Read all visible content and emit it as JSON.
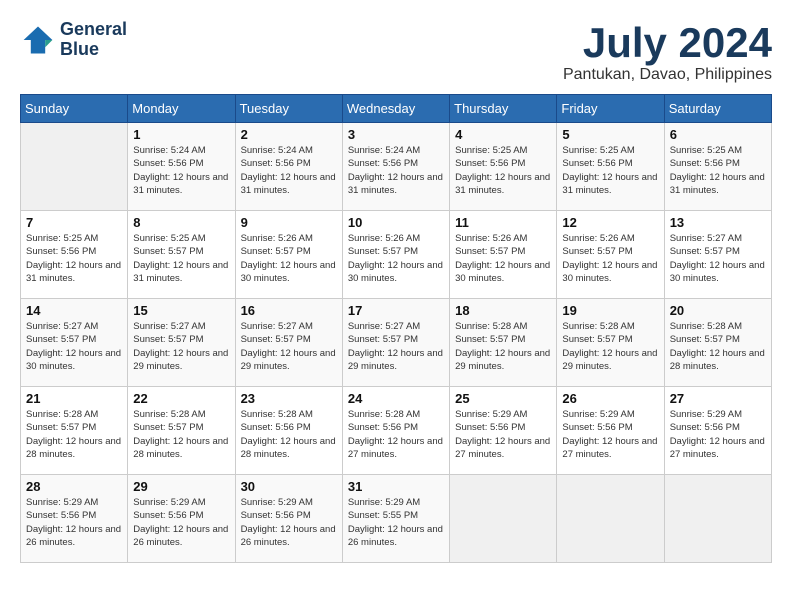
{
  "logo": {
    "line1": "General",
    "line2": "Blue"
  },
  "title": "July 2024",
  "location": "Pantukan, Davao, Philippines",
  "days_of_week": [
    "Sunday",
    "Monday",
    "Tuesday",
    "Wednesday",
    "Thursday",
    "Friday",
    "Saturday"
  ],
  "weeks": [
    [
      {
        "num": "",
        "empty": true
      },
      {
        "num": "1",
        "sunrise": "5:24 AM",
        "sunset": "5:56 PM",
        "daylight": "12 hours and 31 minutes."
      },
      {
        "num": "2",
        "sunrise": "5:24 AM",
        "sunset": "5:56 PM",
        "daylight": "12 hours and 31 minutes."
      },
      {
        "num": "3",
        "sunrise": "5:24 AM",
        "sunset": "5:56 PM",
        "daylight": "12 hours and 31 minutes."
      },
      {
        "num": "4",
        "sunrise": "5:25 AM",
        "sunset": "5:56 PM",
        "daylight": "12 hours and 31 minutes."
      },
      {
        "num": "5",
        "sunrise": "5:25 AM",
        "sunset": "5:56 PM",
        "daylight": "12 hours and 31 minutes."
      },
      {
        "num": "6",
        "sunrise": "5:25 AM",
        "sunset": "5:56 PM",
        "daylight": "12 hours and 31 minutes."
      }
    ],
    [
      {
        "num": "7",
        "sunrise": "5:25 AM",
        "sunset": "5:56 PM",
        "daylight": "12 hours and 31 minutes."
      },
      {
        "num": "8",
        "sunrise": "5:25 AM",
        "sunset": "5:57 PM",
        "daylight": "12 hours and 31 minutes."
      },
      {
        "num": "9",
        "sunrise": "5:26 AM",
        "sunset": "5:57 PM",
        "daylight": "12 hours and 30 minutes."
      },
      {
        "num": "10",
        "sunrise": "5:26 AM",
        "sunset": "5:57 PM",
        "daylight": "12 hours and 30 minutes."
      },
      {
        "num": "11",
        "sunrise": "5:26 AM",
        "sunset": "5:57 PM",
        "daylight": "12 hours and 30 minutes."
      },
      {
        "num": "12",
        "sunrise": "5:26 AM",
        "sunset": "5:57 PM",
        "daylight": "12 hours and 30 minutes."
      },
      {
        "num": "13",
        "sunrise": "5:27 AM",
        "sunset": "5:57 PM",
        "daylight": "12 hours and 30 minutes."
      }
    ],
    [
      {
        "num": "14",
        "sunrise": "5:27 AM",
        "sunset": "5:57 PM",
        "daylight": "12 hours and 30 minutes."
      },
      {
        "num": "15",
        "sunrise": "5:27 AM",
        "sunset": "5:57 PM",
        "daylight": "12 hours and 29 minutes."
      },
      {
        "num": "16",
        "sunrise": "5:27 AM",
        "sunset": "5:57 PM",
        "daylight": "12 hours and 29 minutes."
      },
      {
        "num": "17",
        "sunrise": "5:27 AM",
        "sunset": "5:57 PM",
        "daylight": "12 hours and 29 minutes."
      },
      {
        "num": "18",
        "sunrise": "5:28 AM",
        "sunset": "5:57 PM",
        "daylight": "12 hours and 29 minutes."
      },
      {
        "num": "19",
        "sunrise": "5:28 AM",
        "sunset": "5:57 PM",
        "daylight": "12 hours and 29 minutes."
      },
      {
        "num": "20",
        "sunrise": "5:28 AM",
        "sunset": "5:57 PM",
        "daylight": "12 hours and 28 minutes."
      }
    ],
    [
      {
        "num": "21",
        "sunrise": "5:28 AM",
        "sunset": "5:57 PM",
        "daylight": "12 hours and 28 minutes."
      },
      {
        "num": "22",
        "sunrise": "5:28 AM",
        "sunset": "5:57 PM",
        "daylight": "12 hours and 28 minutes."
      },
      {
        "num": "23",
        "sunrise": "5:28 AM",
        "sunset": "5:56 PM",
        "daylight": "12 hours and 28 minutes."
      },
      {
        "num": "24",
        "sunrise": "5:28 AM",
        "sunset": "5:56 PM",
        "daylight": "12 hours and 27 minutes."
      },
      {
        "num": "25",
        "sunrise": "5:29 AM",
        "sunset": "5:56 PM",
        "daylight": "12 hours and 27 minutes."
      },
      {
        "num": "26",
        "sunrise": "5:29 AM",
        "sunset": "5:56 PM",
        "daylight": "12 hours and 27 minutes."
      },
      {
        "num": "27",
        "sunrise": "5:29 AM",
        "sunset": "5:56 PM",
        "daylight": "12 hours and 27 minutes."
      }
    ],
    [
      {
        "num": "28",
        "sunrise": "5:29 AM",
        "sunset": "5:56 PM",
        "daylight": "12 hours and 26 minutes."
      },
      {
        "num": "29",
        "sunrise": "5:29 AM",
        "sunset": "5:56 PM",
        "daylight": "12 hours and 26 minutes."
      },
      {
        "num": "30",
        "sunrise": "5:29 AM",
        "sunset": "5:56 PM",
        "daylight": "12 hours and 26 minutes."
      },
      {
        "num": "31",
        "sunrise": "5:29 AM",
        "sunset": "5:55 PM",
        "daylight": "12 hours and 26 minutes."
      },
      {
        "num": "",
        "empty": true
      },
      {
        "num": "",
        "empty": true
      },
      {
        "num": "",
        "empty": true
      }
    ]
  ]
}
